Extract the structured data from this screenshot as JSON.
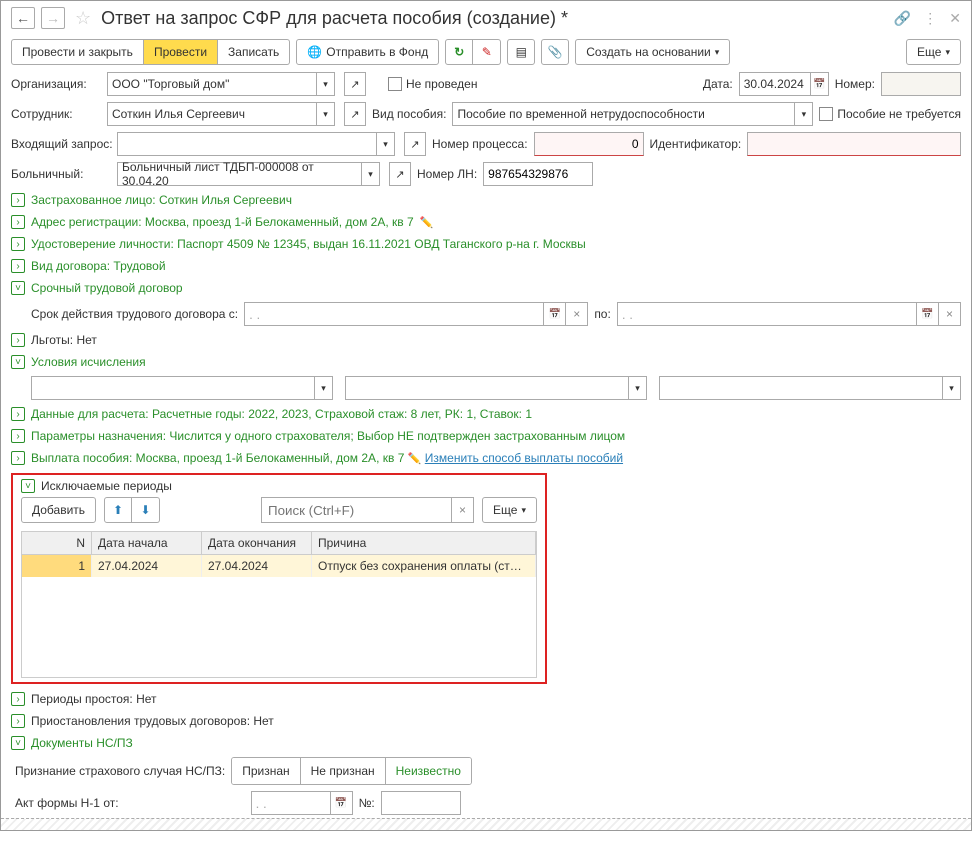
{
  "title": "Ответ на запрос СФР для расчета пособия (создание) *",
  "toolbar": {
    "post_close": "Провести и закрыть",
    "post": "Провести",
    "write": "Записать",
    "send_fund": "Отправить в Фонд",
    "create_based": "Создать на основании",
    "more": "Еще"
  },
  "row1": {
    "org_lbl": "Организация:",
    "org_val": "ООО \"Торговый дом\"",
    "not_posted_lbl": "Не проведен",
    "date_lbl": "Дата:",
    "date_val": "30.04.2024",
    "number_lbl": "Номер:",
    "number_val": ""
  },
  "row2": {
    "emp_lbl": "Сотрудник:",
    "emp_val": "Соткин Илья Сергеевич",
    "type_lbl": "Вид пособия:",
    "type_val": "Пособие по временной нетрудоспособности",
    "not_needed_lbl": "Пособие не требуется"
  },
  "row3": {
    "inc_lbl": "Входящий запрос:",
    "inc_val": "",
    "proc_lbl": "Номер процесса:",
    "proc_val": "0",
    "id_lbl": "Идентификатор:",
    "id_val": ""
  },
  "row4": {
    "sick_lbl": "Больничный:",
    "sick_val": "Больничный лист ТДБП-000008 от 30.04.20",
    "ln_lbl": "Номер ЛН:",
    "ln_val": "987654329876"
  },
  "sections": {
    "insured": "Застрахованное лицо: Соткин Илья Сергеевич",
    "address": "Адрес регистрации: Москва, проезд 1-й Белокаменный, дом 2А, кв 7",
    "id_doc": "Удостоверение личности: Паспорт 4509 № 12345, выдан 16.11.2021 ОВД Таганского р-на г. Москвы",
    "contract": "Вид договора: Трудовой",
    "term": "Срочный трудовой договор",
    "term_from_lbl": "Срок действия трудового договора с:",
    "term_to_lbl": "по:",
    "date_placeholder": ". .",
    "benefits": "Льготы: Нет",
    "calc_cond": "Условия исчисления",
    "calc_data": "Данные для расчета: Расчетные годы: 2022, 2023, Страховой стаж: 8 лет, РК: 1, Ставок: 1",
    "params": "Параметры назначения: Числится у одного страхователя; Выбор НЕ подтвержден застрахованным лицом",
    "payment_pre": "Выплата пособия: Москва, проезд 1-й Белокаменный, дом 2А, кв 7",
    "payment_link": "Изменить способ выплаты пособий",
    "excluded": "Исключаемые периоды",
    "idle": "Периоды простоя: Нет",
    "suspend": "Приостановления трудовых договоров: Нет",
    "ns_docs": "Документы НС/ПЗ",
    "ns_case_lbl": "Признание страхового случая НС/ПЗ:",
    "ns_opts": {
      "yes": "Признан",
      "no": "Не признан",
      "unk": "Неизвестно"
    },
    "act_lbl": "Акт формы Н-1 от:",
    "act_num_lbl": "№:"
  },
  "excluded_block": {
    "add_btn": "Добавить",
    "search_ph": "Поиск (Ctrl+F)",
    "more": "Еще",
    "cols": {
      "n": "N",
      "start": "Дата начала",
      "end": "Дата окончания",
      "reason": "Причина"
    },
    "rows": [
      {
        "n": "1",
        "start": "27.04.2024",
        "end": "27.04.2024",
        "reason": "Отпуск без сохранения оплаты (ст…"
      }
    ]
  }
}
